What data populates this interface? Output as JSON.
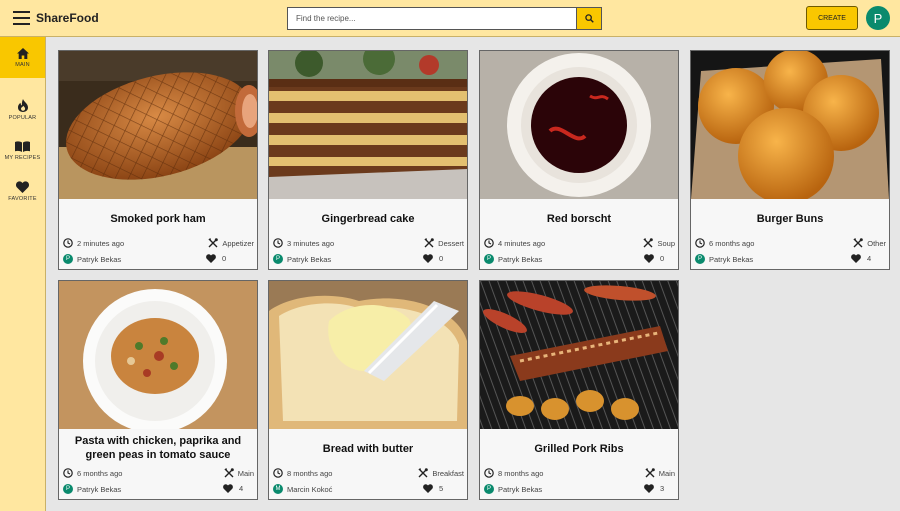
{
  "header": {
    "brand": "ShareFood",
    "search_placeholder": "Find the recipe...",
    "create_label": "CREATE",
    "user_initial": "P"
  },
  "sidebar": {
    "items": [
      {
        "label": "MAIN",
        "icon": "home-icon",
        "active": true
      },
      {
        "label": "POPULAR",
        "icon": "flame-icon",
        "active": false
      },
      {
        "label": "MY RECIPES",
        "icon": "book-icon",
        "active": false
      },
      {
        "label": "FAVORITE",
        "icon": "heart-icon",
        "active": false
      }
    ]
  },
  "recipes": [
    {
      "title": "Smoked pork ham",
      "time": "2 minutes ago",
      "category": "Appetizer",
      "author": "Patryk Bekas",
      "author_initial": "P",
      "likes": "0"
    },
    {
      "title": "Gingerbread cake",
      "time": "3 minutes ago",
      "category": "Dessert",
      "author": "Patryk Bekas",
      "author_initial": "P",
      "likes": "0"
    },
    {
      "title": "Red borscht",
      "time": "4 minutes ago",
      "category": "Soup",
      "author": "Patryk Bekas",
      "author_initial": "P",
      "likes": "0"
    },
    {
      "title": "Burger Buns",
      "time": "6 months ago",
      "category": "Other",
      "author": "Patryk Bekas",
      "author_initial": "P",
      "likes": "4"
    },
    {
      "title": "Pasta with chicken, paprika and green peas in tomato sauce",
      "time": "6 months ago",
      "category": "Main",
      "author": "Patryk Bekas",
      "author_initial": "P",
      "likes": "4"
    },
    {
      "title": "Bread with butter",
      "time": "8 months ago",
      "category": "Breakfast",
      "author": "Marcin Kokoć",
      "author_initial": "M",
      "likes": "5"
    },
    {
      "title": "Grilled Pork Ribs",
      "time": "8 months ago",
      "category": "Main",
      "author": "Patryk Bekas",
      "author_initial": "P",
      "likes": "3"
    }
  ],
  "colors": {
    "header_bg": "#ffe7a0",
    "accent": "#f9c700",
    "avatar": "#0a8a6d",
    "page_bg": "#e6e6e6"
  }
}
